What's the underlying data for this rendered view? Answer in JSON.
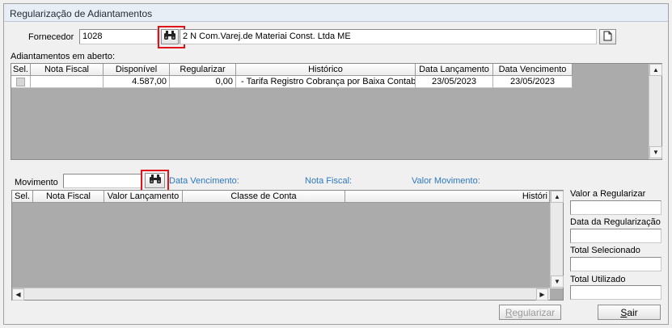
{
  "window": {
    "title": "Regularização de Adiantamentos"
  },
  "fornecedor": {
    "label": "Fornecedor",
    "code": "1028",
    "name": "2 N Com.Varej.de Materiai Const. Ltda ME"
  },
  "adiantamentos": {
    "label": "Adiantamentos em aberto:",
    "columns": [
      "Sel.",
      "Nota Fiscal",
      "Disponível",
      "Regularizar",
      "Histórico",
      "Data Lançamento",
      "Data Vencimento"
    ],
    "rows": [
      {
        "nota_fiscal": "",
        "disponivel": "4.587,00",
        "regularizar": "0,00",
        "historico": " - Tarifa Registro Cobrança por Baixa Contabil",
        "data_lancamento": "23/05/2023",
        "data_vencimento": "23/05/2023"
      }
    ]
  },
  "movimento": {
    "label": "Movimento",
    "value": "",
    "data_vencimento_label": "Data Vencimento:",
    "nota_fiscal_label": "Nota Fiscal:",
    "valor_movimento_label": "Valor Movimento:",
    "columns": [
      "Sel.",
      "Nota Fiscal",
      "Valor Lançamento",
      "Classe de Conta",
      "Históri"
    ]
  },
  "summary": {
    "valor_regularizar_label": "Valor a Regularizar",
    "valor_regularizar": "",
    "data_regularizacao_label": "Data da Regularização",
    "data_regularizacao": "",
    "total_selecionado_label": "Total Selecionado",
    "total_selecionado": "",
    "total_utilizado_label": "Total Utilizado",
    "total_utilizado": ""
  },
  "buttons": {
    "regularizar_first": "R",
    "regularizar_rest": "egularizar",
    "sair_first": "S",
    "sair_rest": "air"
  },
  "icons": {
    "search": "binoculars-icon",
    "new": "new-document-icon"
  },
  "colors": {
    "highlight": "#e0121a",
    "info_labels": "#2f78c0"
  }
}
